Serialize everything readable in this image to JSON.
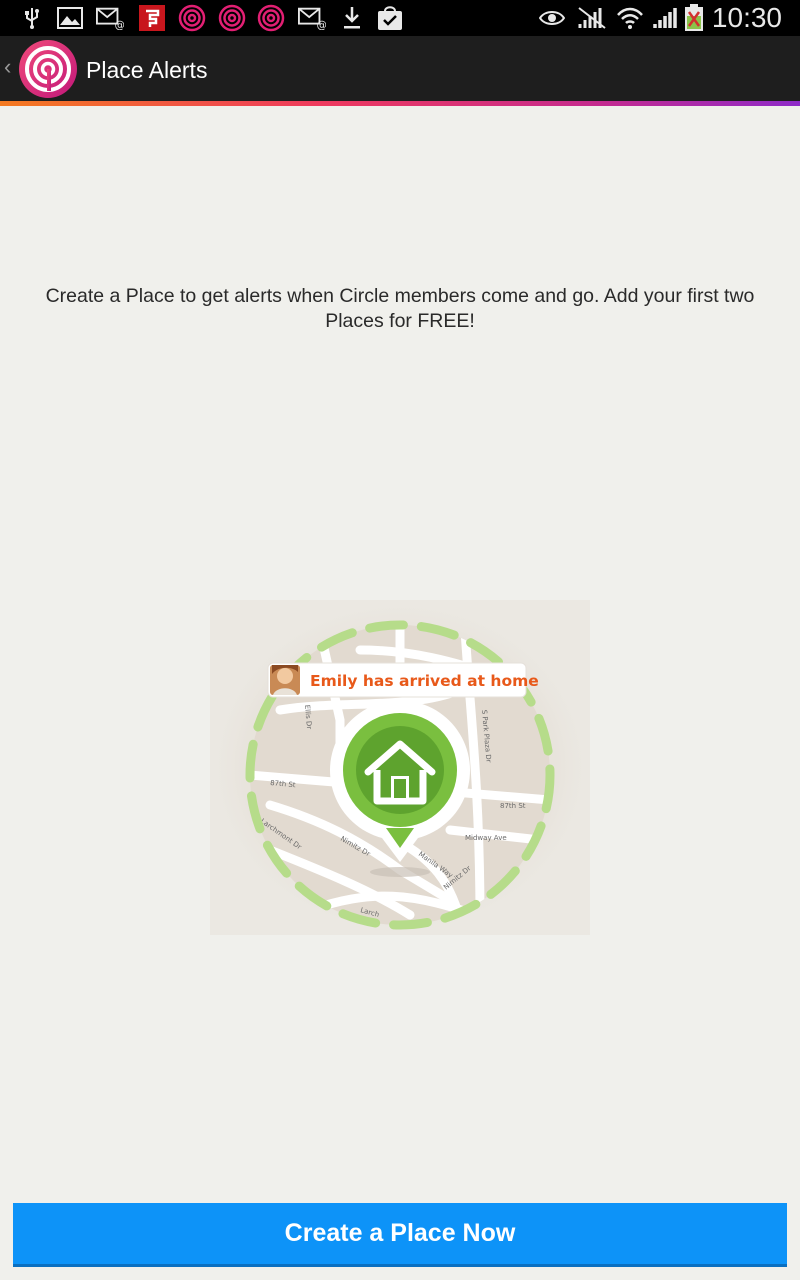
{
  "status_bar": {
    "time": "10:30",
    "left_icons": [
      "usb-icon",
      "image-icon",
      "email-at-icon",
      "flipboard-icon",
      "life360-icon",
      "life360-icon",
      "life360-icon",
      "email-at-icon",
      "download-icon",
      "shopping-bag-check-icon"
    ],
    "right_icons": [
      "eye-icon",
      "no-signal-icon",
      "wifi-icon",
      "cell-signal-icon",
      "battery-charging-icon"
    ]
  },
  "action_bar": {
    "title": "Place Alerts",
    "back_glyph": "‹"
  },
  "content": {
    "intro_text": "Create a Place to get alerts when Circle members come and go. Add your first two Places for FREE!",
    "illustration": {
      "notification_text": "Emily has arrived at home",
      "streets": [
        "87th St",
        "87th St",
        "Midway Ave",
        "Nimitz Dr",
        "Manila Way",
        "Nimitz Dr",
        "S Park Plaza Dr",
        "Ellis Dr",
        "Larchmont Dr",
        "Larch"
      ]
    }
  },
  "footer": {
    "cta_label": "Create a Place Now"
  },
  "colors": {
    "accent_button": "#0d93f8",
    "pin_green": "#6fb63b",
    "notification_orange": "#e8591a",
    "geofence_green": "#b6dc8a"
  }
}
